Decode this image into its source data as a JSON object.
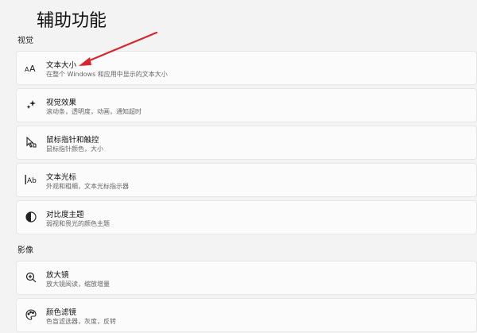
{
  "page_title": "辅助功能",
  "sections": {
    "vision": {
      "header": "视觉",
      "items": [
        {
          "icon": "text-size-icon",
          "title": "文本大小",
          "desc": "在整个 Windows 和应用中显示的文本大小"
        },
        {
          "icon": "visual-effects-icon",
          "title": "视觉效果",
          "desc": "滚动条，透明度，动画，通知超时"
        },
        {
          "icon": "mouse-pointer-touch-icon",
          "title": "鼠标指针和触控",
          "desc": "鼠标指针颜色，大小"
        },
        {
          "icon": "text-cursor-icon",
          "title": "文本光标",
          "desc": "外观和粗细，文本光标指示器"
        },
        {
          "icon": "contrast-theme-icon",
          "title": "对比度主题",
          "desc": "弱视和畏光的颜色主题"
        }
      ]
    },
    "hearing": {
      "header": "影像",
      "items": [
        {
          "icon": "magnifier-icon",
          "title": "放大镜",
          "desc": "放大镜阅读，缩放增量"
        },
        {
          "icon": "color-filter-icon",
          "title": "颜色滤镜",
          "desc": "色盲滤选器，灰度，反转"
        }
      ]
    }
  },
  "annotation": {
    "color": "#d9262c"
  }
}
